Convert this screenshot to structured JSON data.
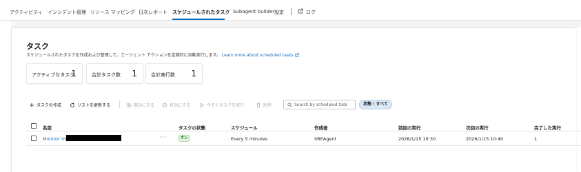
{
  "nav": {
    "tabs": [
      {
        "label": "アクティビティ"
      },
      {
        "label": "インシデント管理"
      },
      {
        "label": "リソース マッピング"
      },
      {
        "label": "日次レポート"
      },
      {
        "label": "スケジュールされたタスク"
      },
      {
        "label": "Subagent builder"
      },
      {
        "label": "設定"
      }
    ],
    "active_index": 4,
    "log_label": "ログ"
  },
  "page": {
    "title": "タスク",
    "subtitle": "スケジュールされたタスクを作成および管理して、エージェント アクションを定期的に自動実行します。",
    "learn_more": "Learn more about scheduled tasks"
  },
  "stats": [
    {
      "label": "アクティブなタスク",
      "value": "1"
    },
    {
      "label": "合計タスク数",
      "value": "1"
    },
    {
      "label": "合計実行数",
      "value": "1"
    }
  ],
  "toolbar": {
    "create": "タスクの作成",
    "refresh": "リストを更新する",
    "disable": "無効にする",
    "enable": "有効にする",
    "run_now": "今すぐタスクを実行",
    "delete": "削除",
    "search_placeholder": "Search by scheduled task",
    "filter": "状態 : すべて"
  },
  "table": {
    "columns": [
      "名前",
      "タスクの状態",
      "スケジュール",
      "作成者",
      "前回の実行",
      "次回の実行",
      "完了した実行"
    ],
    "rows": [
      {
        "name": "Monitor VM",
        "status": "オン",
        "schedule": "Every 5 minutes",
        "author": "SREAgent",
        "last_run": "2026/1/15 10:30",
        "next_run": "2026/1/15 10:40",
        "completed": "1"
      }
    ]
  },
  "colors": {
    "accent": "#0f6cbd",
    "status_on": "#107c10",
    "filter_bg": "#dbe8f7"
  }
}
